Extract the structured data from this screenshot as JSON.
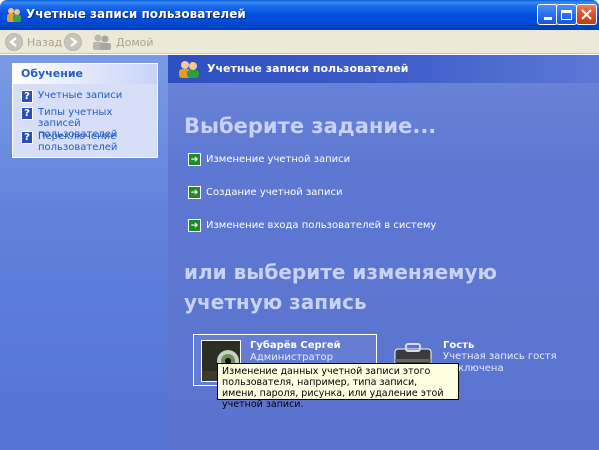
{
  "window": {
    "title": "Учетные записи пользователей"
  },
  "toolbar": {
    "back_label": "Назад",
    "home_label": "Домой"
  },
  "learn": {
    "heading": "Обучение",
    "items": [
      {
        "label": "Учетные записи"
      },
      {
        "label": "Типы учетных записей пользователей"
      },
      {
        "label": "Переключение пользователей"
      }
    ]
  },
  "header": {
    "title": "Учетные записи пользователей"
  },
  "main": {
    "pick_task_heading": "Выберите задание...",
    "tasks": [
      {
        "label": "Изменение учетной записи"
      },
      {
        "label": "Создание учетной записи"
      },
      {
        "label": "Изменение входа пользователей в систему"
      }
    ],
    "pick_account_heading": "или выберите изменяемую учетную запись"
  },
  "accounts": [
    {
      "name": "Губарёв Сергей",
      "description": "Администратор компьютера"
    },
    {
      "name": "Гость",
      "description_line1": "Учетная запись гостя",
      "description_line2": "ключена"
    }
  ],
  "tooltip": {
    "text": "Изменение данных учетной записи этого пользователя, например, типа записи, имени, пароля, рисунка, или удаление этой учетной записи."
  },
  "colors": {
    "title_bar": "#0050e0",
    "left_pane": "#6181dc",
    "right_pane": "#5d77d2",
    "tooltip_bg": "#ffffe1",
    "task_icon": "#1e8a2e"
  }
}
